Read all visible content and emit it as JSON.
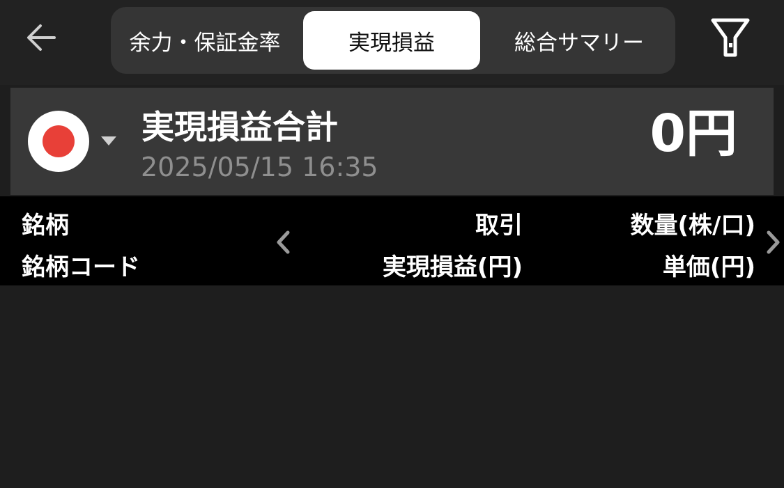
{
  "header": {
    "tabs": [
      {
        "label": "余力・保証金率",
        "selected": false
      },
      {
        "label": "実現損益",
        "selected": true
      },
      {
        "label": "総合サマリー",
        "selected": false
      }
    ]
  },
  "icons": {
    "back": "back-arrow-icon",
    "filter": "filter-icon",
    "flag": "japan-flag-icon",
    "caret": "caret-down-icon",
    "prev": "chevron-left-icon",
    "next": "chevron-right-icon"
  },
  "summary": {
    "title": "実現損益合計",
    "datetime": "2025/05/15 16:35",
    "value": "0円"
  },
  "table_header": {
    "col1_line1": "銘柄",
    "col1_line2": "銘柄コード",
    "col2_line1": "取引",
    "col2_line2": "実現損益(円)",
    "col3_line1": "数量(株/口)",
    "col3_line2": "単価(円)"
  },
  "colors": {
    "background": "#1e1e1e",
    "topbar": "#222222",
    "tab_track": "#353535",
    "tab_selected": "#ffffff",
    "summary_panel": "#383838",
    "header_band": "#000000",
    "date_text": "#8f8f8f",
    "flag_red": "#e84038"
  }
}
